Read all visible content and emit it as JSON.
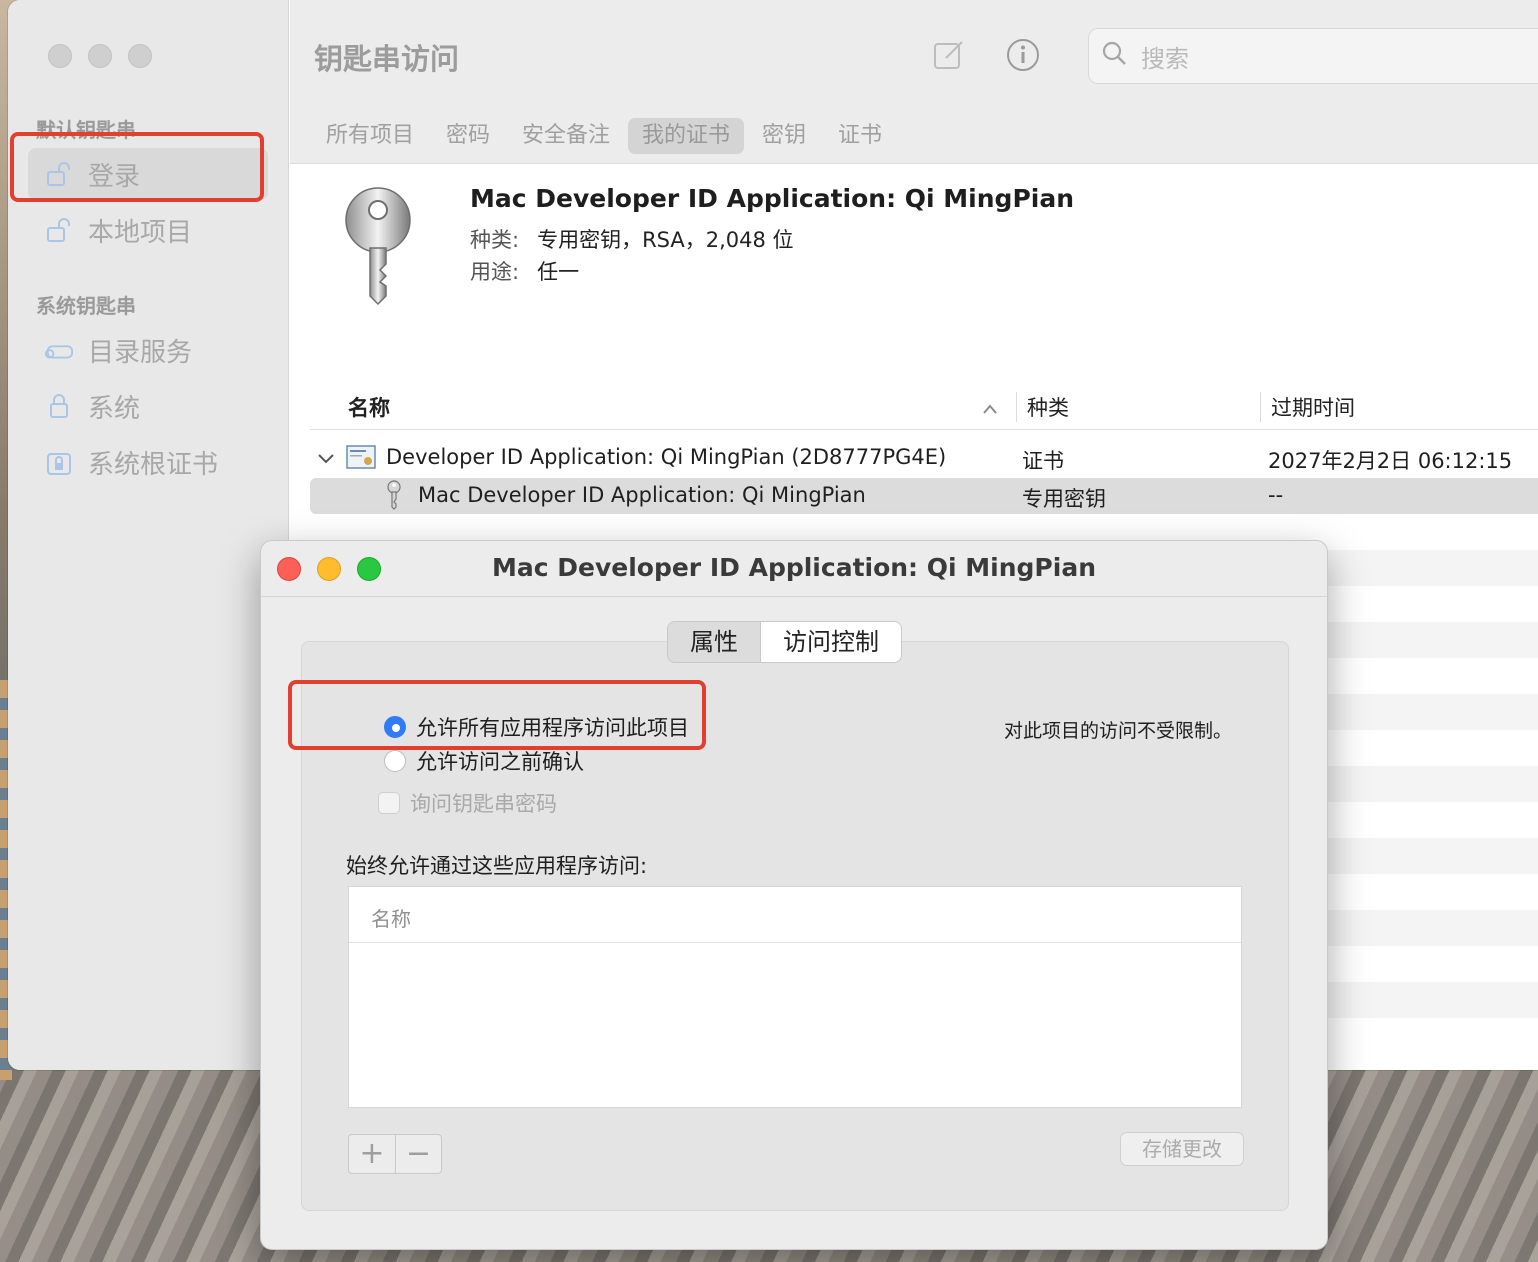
{
  "app": {
    "title": "钥匙串访问",
    "search_placeholder": "搜索"
  },
  "sidebar": {
    "default_section": "默认钥匙串",
    "system_section": "系统钥匙串",
    "items": [
      {
        "label": "登录",
        "icon": "unlocked-padlock-icon",
        "selected": true
      },
      {
        "label": "本地项目",
        "icon": "unlocked-padlock-icon",
        "selected": false
      },
      {
        "label": "目录服务",
        "icon": "directory-service-icon",
        "selected": false
      },
      {
        "label": "系统",
        "icon": "padlock-icon",
        "selected": false
      },
      {
        "label": "系统根证书",
        "icon": "cabinet-lock-icon",
        "selected": false
      }
    ]
  },
  "tabs": [
    {
      "label": "所有项目",
      "active": false
    },
    {
      "label": "密码",
      "active": false
    },
    {
      "label": "安全备注",
      "active": false
    },
    {
      "label": "我的证书",
      "active": true
    },
    {
      "label": "密钥",
      "active": false
    },
    {
      "label": "证书",
      "active": false
    }
  ],
  "detail": {
    "name": "Mac Developer ID Application: Qi MingPian",
    "kind_label": "种类:",
    "kind_value": "专用密钥，RSA，2,048 位",
    "usage_label": "用途:",
    "usage_value": "任一"
  },
  "table": {
    "columns": [
      "名称",
      "种类",
      "过期时间"
    ],
    "rows": [
      {
        "name": "Developer ID Application: Qi MingPian (2D8777PG4E)",
        "kind": "证书",
        "expires": "2027年2月2日 06:12:15",
        "selected": false,
        "icon": "certificate-icon"
      },
      {
        "name": "Mac Developer ID Application: Qi MingPian",
        "kind": "专用密钥",
        "expires": "--",
        "selected": true,
        "icon": "key-icon"
      }
    ]
  },
  "dialog": {
    "title": "Mac Developer ID Application: Qi MingPian",
    "tab_attributes": "属性",
    "tab_access": "访问控制",
    "option_allow_all": "允许所有应用程序访问此项目",
    "option_confirm": "允许访问之前确认",
    "checkbox_ask_password": "询问钥匙串密码",
    "description": "对此项目的访问不受限制。",
    "always_allow_label": "始终允许通过这些应用程序访问:",
    "list_header": "名称",
    "add_label": "+",
    "remove_label": "−",
    "save_label": "存储更改"
  },
  "colors": {
    "highlight_box": "#e2402f",
    "radio_accent": "#2f7cf6"
  }
}
